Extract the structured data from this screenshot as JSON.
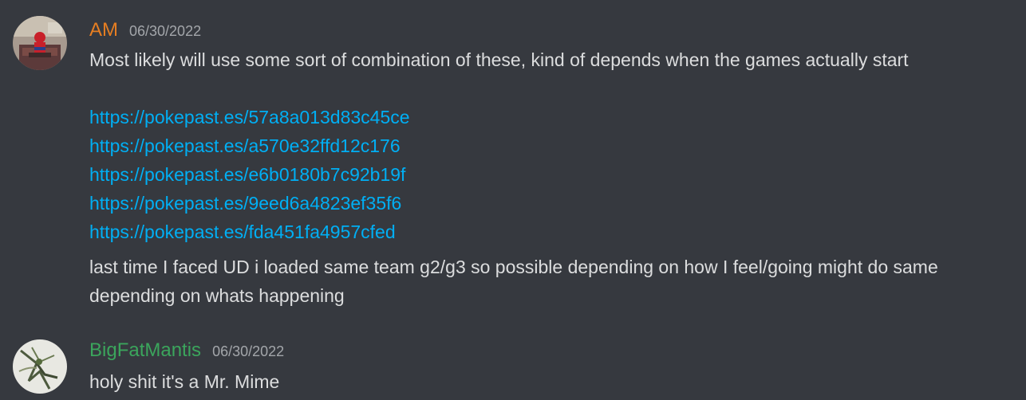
{
  "messages": [
    {
      "username": "AM",
      "username_color": "#e67e22",
      "timestamp": "06/30/2022",
      "text": "Most likely will use some sort of combination of these, kind of depends when the games actually start",
      "links": [
        "https://pokepast.es/57a8a013d83c45ce",
        "https://pokepast.es/a570e32ffd12c176",
        "https://pokepast.es/e6b0180b7c92b19f",
        "https://pokepast.es/9eed6a4823ef35f6",
        "https://pokepast.es/fda451fa4957cfed"
      ],
      "followup_line1": "last time I faced UD i loaded same team g2/g3 so possible depending on how I feel/going might do same",
      "followup_line2": "depending on whats happening"
    },
    {
      "username": "BigFatMantis",
      "username_color": "#3ba55c",
      "timestamp": "06/30/2022",
      "text": "holy shit it's a Mr. Mime"
    }
  ],
  "colors": {
    "background": "#36393f",
    "text": "#dcddde",
    "timestamp": "#a3a6aa",
    "link": "#00aff4"
  }
}
